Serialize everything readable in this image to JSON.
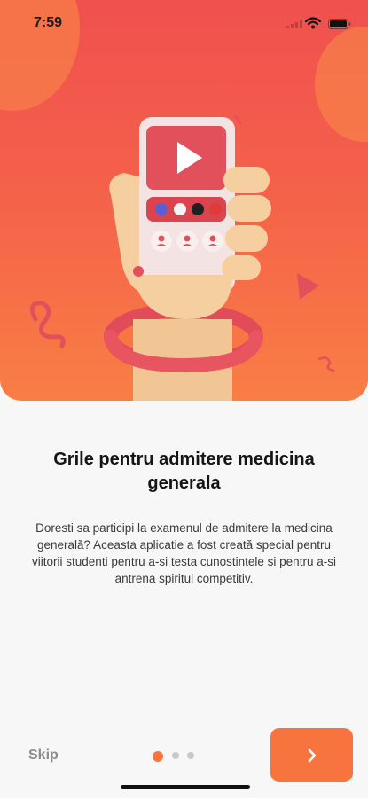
{
  "status_bar": {
    "time": "7:59"
  },
  "onboarding": {
    "title": "Grile pentru admitere medicina generala",
    "description": "Doresti sa participi la examenul de admitere la medicina generală? Aceasta aplicatie a fost creată special pentru viitorii studenti pentru a-si testa cunostintele si  pentru a-si antrena spiritul competitiv.",
    "skip_label": "Skip",
    "page_indicator": {
      "total": 3,
      "current": 1
    },
    "next_icon": "chevron-right-icon"
  },
  "colors": {
    "accent": "#f7743f",
    "hero_top": "#f0504e",
    "hero_bottom": "#f97e45",
    "inactive_dot": "#c9c9c9"
  }
}
